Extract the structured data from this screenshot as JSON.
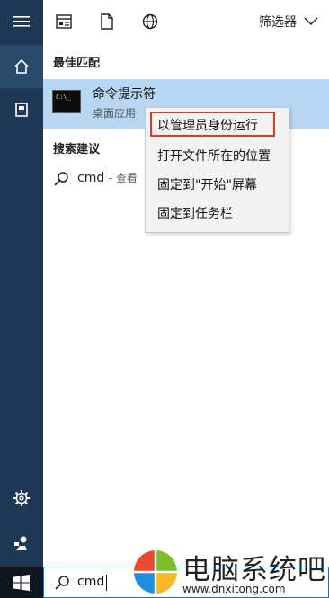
{
  "rail": {
    "items": [
      {
        "name": "hamburger-icon"
      },
      {
        "name": "home-icon"
      },
      {
        "name": "documents-icon"
      },
      {
        "name": "settings-icon"
      },
      {
        "name": "user-icon"
      }
    ]
  },
  "toolbar": {
    "icons": [
      "apps-icon",
      "documents-icon",
      "web-icon"
    ],
    "filter_label": "筛选器"
  },
  "best_match": {
    "section_title": "最佳匹配",
    "title": "命令提示符",
    "subtitle": "桌面应用"
  },
  "suggestions": {
    "section_title": "搜索建议",
    "query": "cmd",
    "hint": "- 查看"
  },
  "context_menu": {
    "items": [
      "以管理员身份运行",
      "打开文件所在的位置",
      "固定到\"开始\"屏幕",
      "固定到任务栏"
    ]
  },
  "taskbar": {
    "search_value": "cmd"
  },
  "watermark": {
    "text": "电脑系统吧",
    "url": "www.dnxitong.com"
  },
  "colors": {
    "rail_bg": "#1f3855",
    "selected_bg": "#b8d6f1",
    "highlight_border": "#e0392b"
  }
}
